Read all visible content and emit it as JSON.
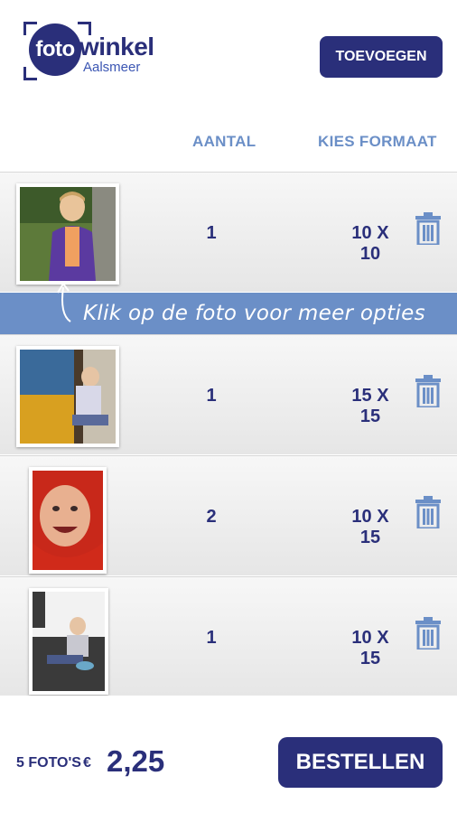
{
  "brand": {
    "logo_circle_text": "foto",
    "logo_word": "winkel",
    "logo_sub": "Aalsmeer"
  },
  "header": {
    "add_button": "TOEVOEGEN"
  },
  "columns": {
    "quantity": "AANTAL",
    "format": "KIES FORMAAT"
  },
  "hint": {
    "text": "Klik op de foto voor meer opties",
    "arrow_icon": "curved-arrow-up-icon"
  },
  "items": [
    {
      "photo": "girl in purple jacket on lawn",
      "quantity": "1",
      "format": "10 X 10"
    },
    {
      "photo": "child playing arcade game",
      "quantity": "1",
      "format": "15 X 15"
    },
    {
      "photo": "child in red hood close-up",
      "quantity": "2",
      "format": "10 X 15"
    },
    {
      "photo": "toddler sitting on floor with bowl",
      "quantity": "1",
      "format": "10 X 15"
    }
  ],
  "footer": {
    "photo_count": "5 FOTO'S",
    "currency": "€",
    "total": "2,25",
    "order_button": "BESTELLEN"
  },
  "icons": {
    "delete": "trash-icon"
  },
  "colors": {
    "primary": "#2a2f7a",
    "accent": "#6b8fc7",
    "row_bg": "#ececec"
  }
}
